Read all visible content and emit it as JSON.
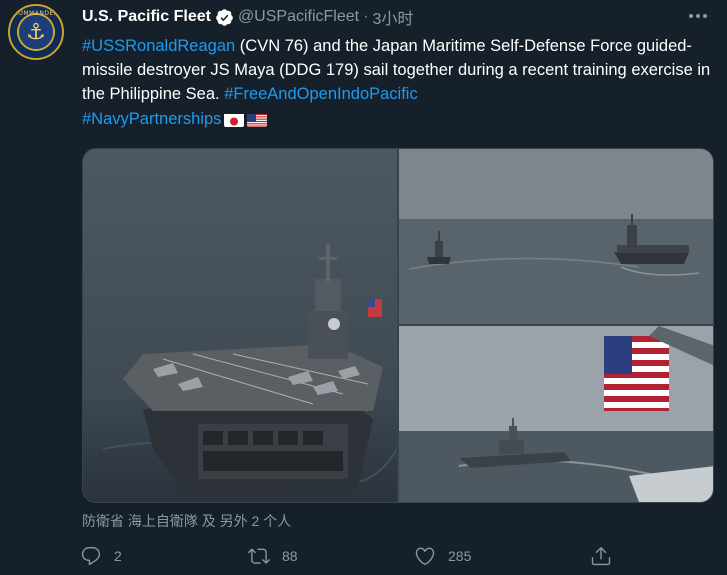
{
  "account": {
    "name": "U.S. Pacific Fleet",
    "handle": "@USPacificFleet",
    "separator": "·",
    "time": "3小时",
    "avatar_text": "COMMANDER",
    "verified_icon": "verified-badge-icon"
  },
  "tweet": {
    "hashtag_ship": "#USSRonaldReagan",
    "text_part1": " (CVN 76) and the Japan Maritime Self-Defense Force guided-missile destroyer JS Maya (DDG 179) sail together during a recent training exercise in the Philippine Sea. ",
    "hashtag_indopacific": "#FreeAndOpenIndoPacific",
    "hashtag_partnerships": "#NavyPartnerships",
    "flags": [
      "japan-flag-icon",
      "us-flag-icon"
    ]
  },
  "media": {
    "photos": [
      {
        "subject": "aircraft-carrier-photo"
      },
      {
        "subject": "two-ships-formation-photo"
      },
      {
        "subject": "destroyer-with-us-flag-photo"
      }
    ]
  },
  "tagged": {
    "text": "防衛省 海上自衛隊 及 另外 2 个人"
  },
  "actions": {
    "reply_count": "2",
    "retweet_count": "88",
    "like_count": "285"
  },
  "colors": {
    "background": "#15202b",
    "link": "#1d9bf0",
    "secondary_text": "#8899a6",
    "border": "#38444d"
  }
}
